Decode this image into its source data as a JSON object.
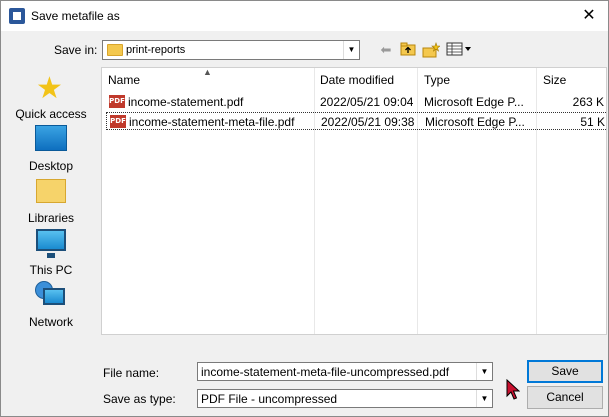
{
  "window": {
    "title": "Save metafile as"
  },
  "toolbar": {
    "save_in_label": "Save in:",
    "save_in_value": "print-reports"
  },
  "places": [
    {
      "label": "Quick access",
      "icon": "star-icon"
    },
    {
      "label": "Desktop",
      "icon": "desktop-icon"
    },
    {
      "label": "Libraries",
      "icon": "libraries-icon"
    },
    {
      "label": "This PC",
      "icon": "computer-icon"
    },
    {
      "label": "Network",
      "icon": "network-icon"
    }
  ],
  "filelist": {
    "columns": [
      "Name",
      "Date modified",
      "Type",
      "Size"
    ],
    "rows": [
      {
        "name": "income-statement.pdf",
        "date": "2022/05/21 09:04",
        "type": "Microsoft Edge P...",
        "size": "263 K"
      },
      {
        "name": "income-statement-meta-file.pdf",
        "date": "2022/05/21 09:38",
        "type": "Microsoft Edge P...",
        "size": "51 K"
      }
    ]
  },
  "form": {
    "file_name_label": "File name:",
    "file_name_value": "income-statement-meta-file-uncompressed.pdf",
    "save_as_type_label": "Save as type:",
    "save_as_type_value": "PDF File - uncompressed"
  },
  "buttons": {
    "save": "Save",
    "cancel": "Cancel"
  },
  "colors": {
    "accent": "#0078d7",
    "pdf_icon": "#c0392b",
    "folder": "#f4c84e"
  }
}
